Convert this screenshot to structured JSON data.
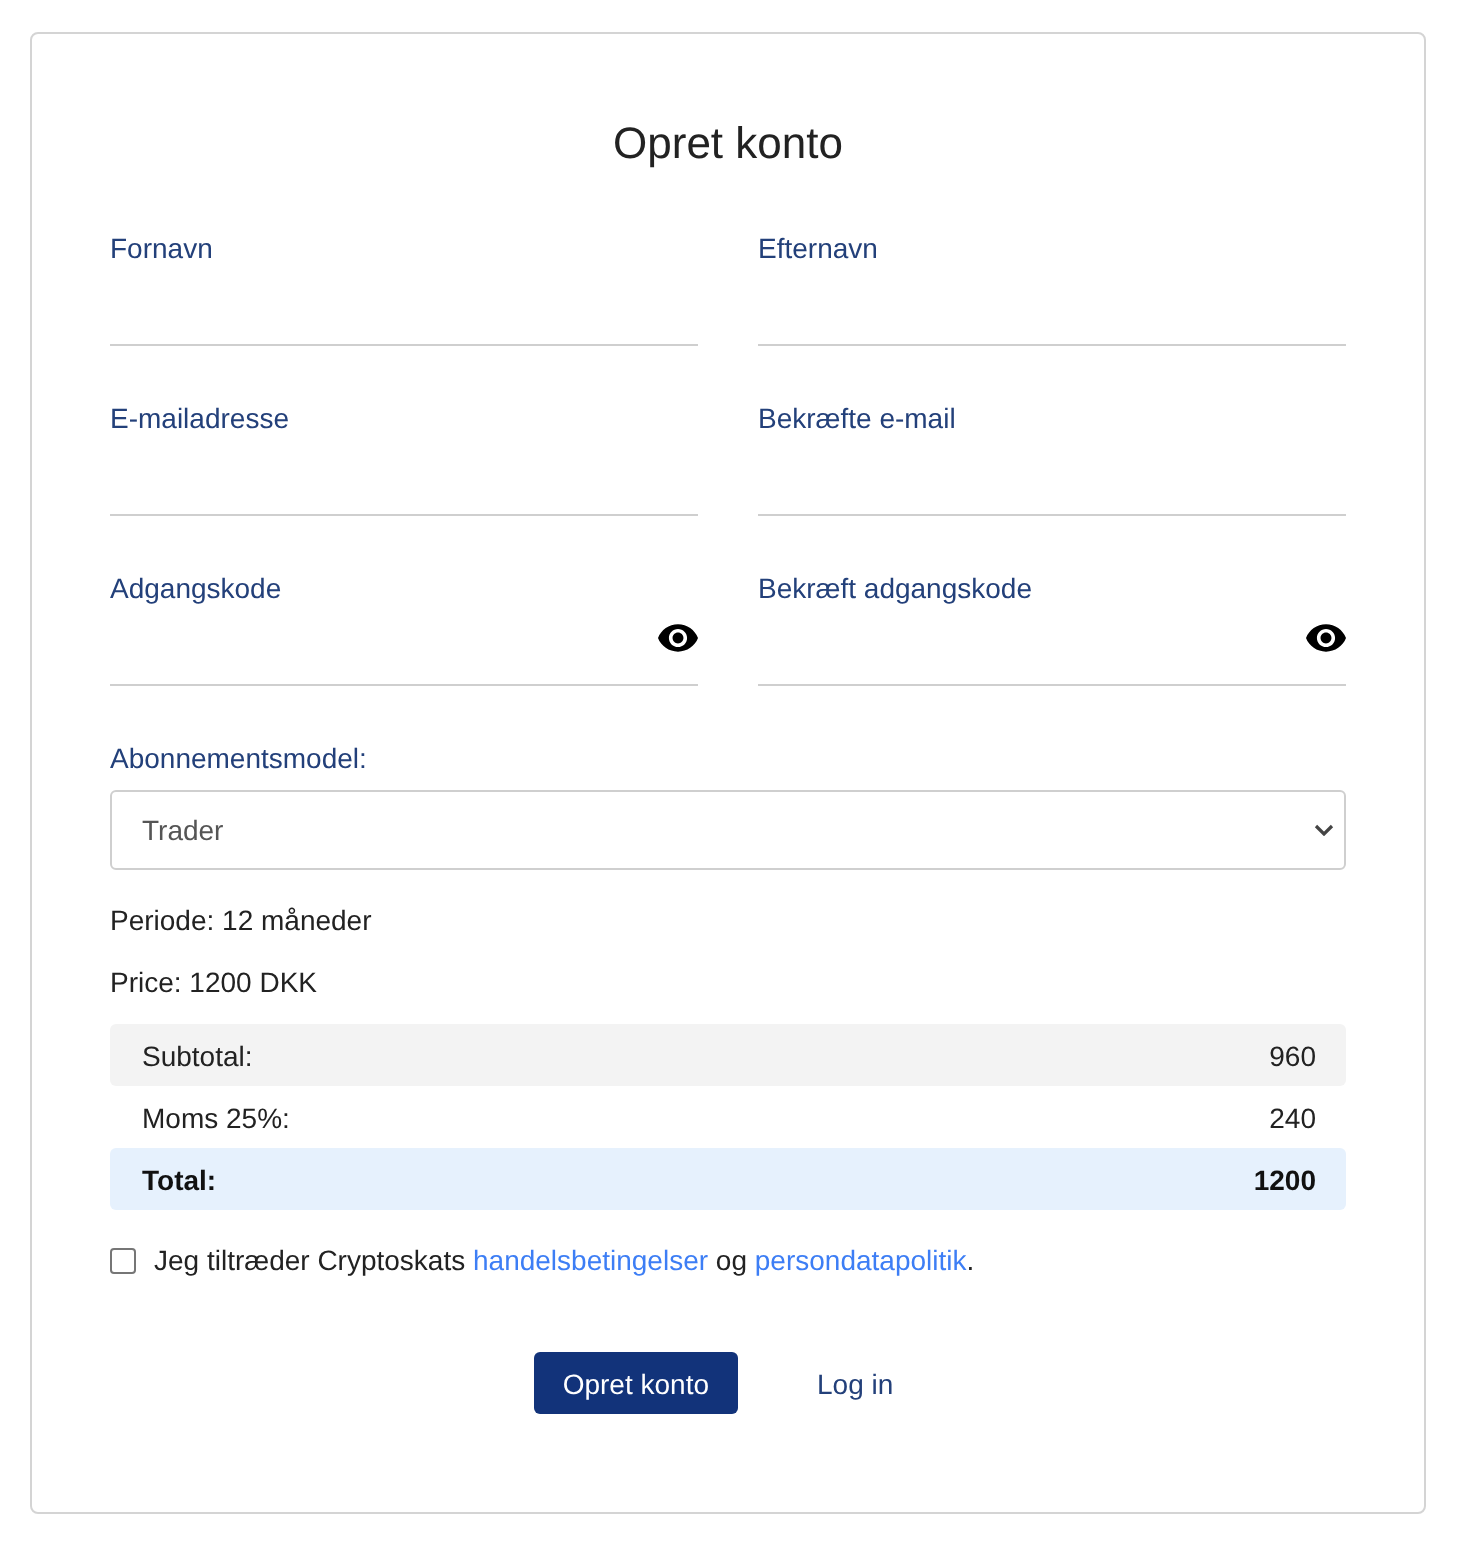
{
  "title": "Opret konto",
  "fields": [
    {
      "label": "Fornavn",
      "kind": "text"
    },
    {
      "label": "Efternavn",
      "kind": "text"
    },
    {
      "label": "E-mailadresse",
      "kind": "text"
    },
    {
      "label": "Bekræfte e-mail",
      "kind": "text"
    },
    {
      "label": "Adgangskode",
      "kind": "password"
    },
    {
      "label": "Bekræft adgangskode",
      "kind": "password"
    }
  ],
  "subscription": {
    "label": "Abonnementsmodel:",
    "value": "Trader"
  },
  "details": [
    "Periode: 12 måneder",
    "Price: 1200 DKK"
  ],
  "summary": [
    {
      "label": "Subtotal:",
      "value": "960",
      "kind": "subtotal"
    },
    {
      "label": "Moms 25%:",
      "value": "240",
      "kind": "tax"
    },
    {
      "label": "Total:",
      "value": "1200",
      "kind": "total"
    }
  ],
  "terms": {
    "checked": false,
    "parts": [
      {
        "kind": "text",
        "text": "Jeg tiltræder Cryptoskats "
      },
      {
        "kind": "link",
        "text": "handelsbetingelser"
      },
      {
        "kind": "text",
        "text": " og "
      },
      {
        "kind": "link",
        "text": "persondatapolitik"
      },
      {
        "kind": "text",
        "text": "."
      }
    ]
  },
  "buttons": [
    {
      "label": "Opret konto",
      "kind": "primary"
    },
    {
      "label": "Log in",
      "kind": "link"
    }
  ]
}
